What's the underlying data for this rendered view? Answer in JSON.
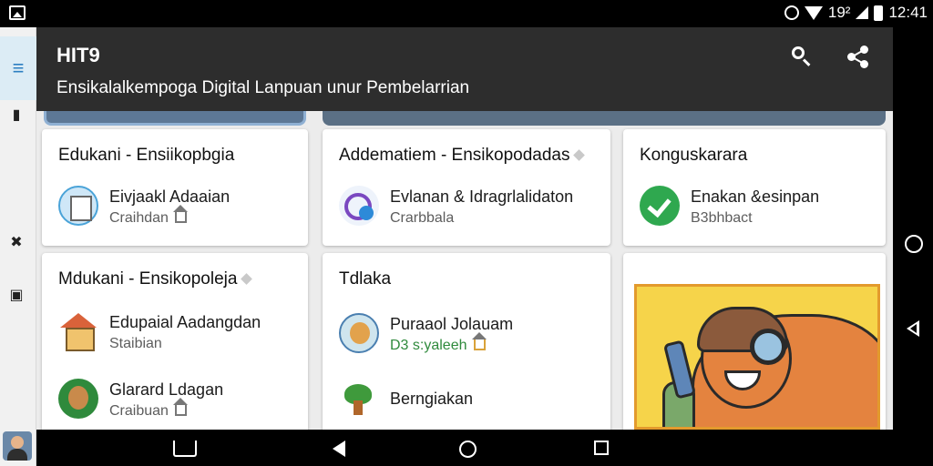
{
  "status_bar": {
    "time": "12:41",
    "signal_text": "19²"
  },
  "toolbar": {
    "title": "HIT9",
    "subtitle": "Ensikalalkempoga Digital Lanpuan unur Pembelarrian",
    "icons": [
      "search-icon",
      "share-icon",
      "more-vert-icon"
    ]
  },
  "cards": [
    {
      "title": "Edukani - Ensiikopbgia",
      "items": [
        {
          "icon": "document-icon",
          "label": "Eivjaakl Adaaian",
          "sub": "Craihdan"
        }
      ]
    },
    {
      "title": "Addematiem - Ensikopodadas",
      "items": [
        {
          "icon": "chat-icon",
          "label": "Evlanan & Idragrlalidaton",
          "sub": "Crarbbala"
        }
      ]
    },
    {
      "title": "Konguskarara",
      "items": [
        {
          "icon": "check-icon",
          "label": "Enakan &esinpan",
          "sub": "B3bhbact"
        }
      ]
    },
    {
      "title": "Mdukani - Ensikopoleja",
      "items": [
        {
          "icon": "house-icon",
          "label": "Edupaial Aadangdan",
          "sub": "Staibian"
        },
        {
          "icon": "avatar-icon",
          "label": "Glarard Ldagan",
          "sub": "Craibuan"
        }
      ]
    },
    {
      "title": "Tdlaka",
      "items": [
        {
          "icon": "character-icon",
          "label": "Puraaol Jolauam",
          "sub": "D3 s:yaleeh"
        },
        {
          "icon": "plant-icon",
          "label": "Berngiakan",
          "sub": ""
        }
      ]
    }
  ],
  "colors": {
    "toolbar_bg": "#2d2d2d",
    "card_bg": "#ffffff",
    "accent_blue": "#2d7fc1",
    "check_green": "#2fa84f"
  }
}
